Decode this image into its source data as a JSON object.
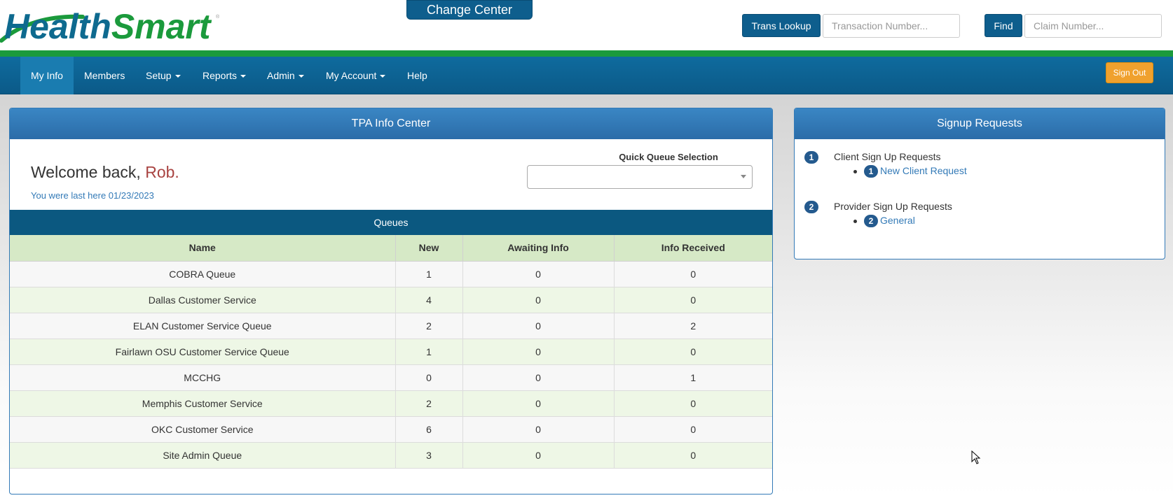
{
  "header": {
    "logo_text": "HealthSmart",
    "change_center_label": "Change Center",
    "trans_lookup_label": "Trans Lookup",
    "transaction_placeholder": "Transaction Number...",
    "find_label": "Find",
    "claim_placeholder": "Claim Number..."
  },
  "nav": {
    "items": [
      {
        "label": "My Info",
        "active": true
      },
      {
        "label": "Members"
      },
      {
        "label": "Setup",
        "dropdown": true
      },
      {
        "label": "Reports",
        "dropdown": true
      },
      {
        "label": "Admin",
        "dropdown": true
      },
      {
        "label": "My Account",
        "dropdown": true
      },
      {
        "label": "Help"
      }
    ],
    "signout_label": "Sign Out"
  },
  "info_center": {
    "title": "TPA Info Center",
    "welcome_prefix": "Welcome back,",
    "user_name": "Rob.",
    "last_here": "You were last here 01/23/2023",
    "quick_queue_label": "Quick Queue Selection",
    "quick_queue_value": "",
    "queues_title": "Queues",
    "columns": [
      "Name",
      "New",
      "Awaiting Info",
      "Info Received"
    ],
    "rows": [
      {
        "name": "COBRA Queue",
        "new": "1",
        "awaiting": "0",
        "received": "0"
      },
      {
        "name": "Dallas Customer Service",
        "new": "4",
        "awaiting": "0",
        "received": "0"
      },
      {
        "name": "ELAN Customer Service Queue",
        "new": "2",
        "awaiting": "0",
        "received": "2"
      },
      {
        "name": "Fairlawn OSU Customer Service Queue",
        "new": "1",
        "awaiting": "0",
        "received": "0"
      },
      {
        "name": "MCCHG",
        "new": "0",
        "awaiting": "0",
        "received": "1"
      },
      {
        "name": "Memphis Customer Service",
        "new": "2",
        "awaiting": "0",
        "received": "0"
      },
      {
        "name": "OKC Customer Service",
        "new": "6",
        "awaiting": "0",
        "received": "0"
      },
      {
        "name": "Site Admin Queue",
        "new": "3",
        "awaiting": "0",
        "received": "0"
      }
    ]
  },
  "signup": {
    "title": "Signup Requests",
    "groups": [
      {
        "count": "1",
        "label": "Client Sign Up Requests",
        "item_count": "1",
        "item_label": "New Client Request"
      },
      {
        "count": "2",
        "label": "Provider Sign Up Requests",
        "item_count": "2",
        "item_label": "General"
      }
    ]
  },
  "colors": {
    "brand_blue": "#0e5e8d",
    "brand_green": "#1b9a3c",
    "panel_header": "#2b6ca8",
    "signout_orange": "#f0a12e",
    "table_header": "#d6e9c6"
  }
}
